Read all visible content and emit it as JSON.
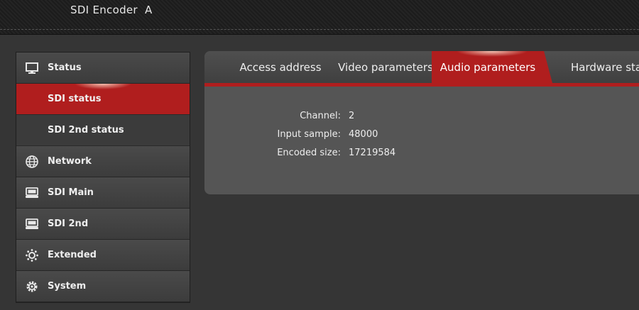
{
  "app": {
    "title": "SDI Encoder  A"
  },
  "sidebar": {
    "items": [
      {
        "label": "Status",
        "icon": "monitor-icon"
      },
      {
        "label": "SDI status",
        "active": true
      },
      {
        "label": "SDI 2nd status"
      },
      {
        "label": "Network",
        "icon": "globe-icon"
      },
      {
        "label": "SDI Main",
        "icon": "device-icon"
      },
      {
        "label": "SDI 2nd",
        "icon": "device-icon"
      },
      {
        "label": "Extended",
        "icon": "settings-dots-icon"
      },
      {
        "label": "System",
        "icon": "gear-icon"
      }
    ]
  },
  "tabs": [
    {
      "label": "Access address"
    },
    {
      "label": "Video parameters"
    },
    {
      "label": "Audio parameters",
      "active": true
    },
    {
      "label": "Hardware stat"
    }
  ],
  "audio": {
    "channel_label": "Channel:",
    "channel_value": "2",
    "sample_label": "Input sample:",
    "sample_value": "48000",
    "size_label": "Encoded size:",
    "size_value": "17219584"
  },
  "colors": {
    "accent": "#b01e1e",
    "panel": "#555555",
    "background": "#353535"
  }
}
